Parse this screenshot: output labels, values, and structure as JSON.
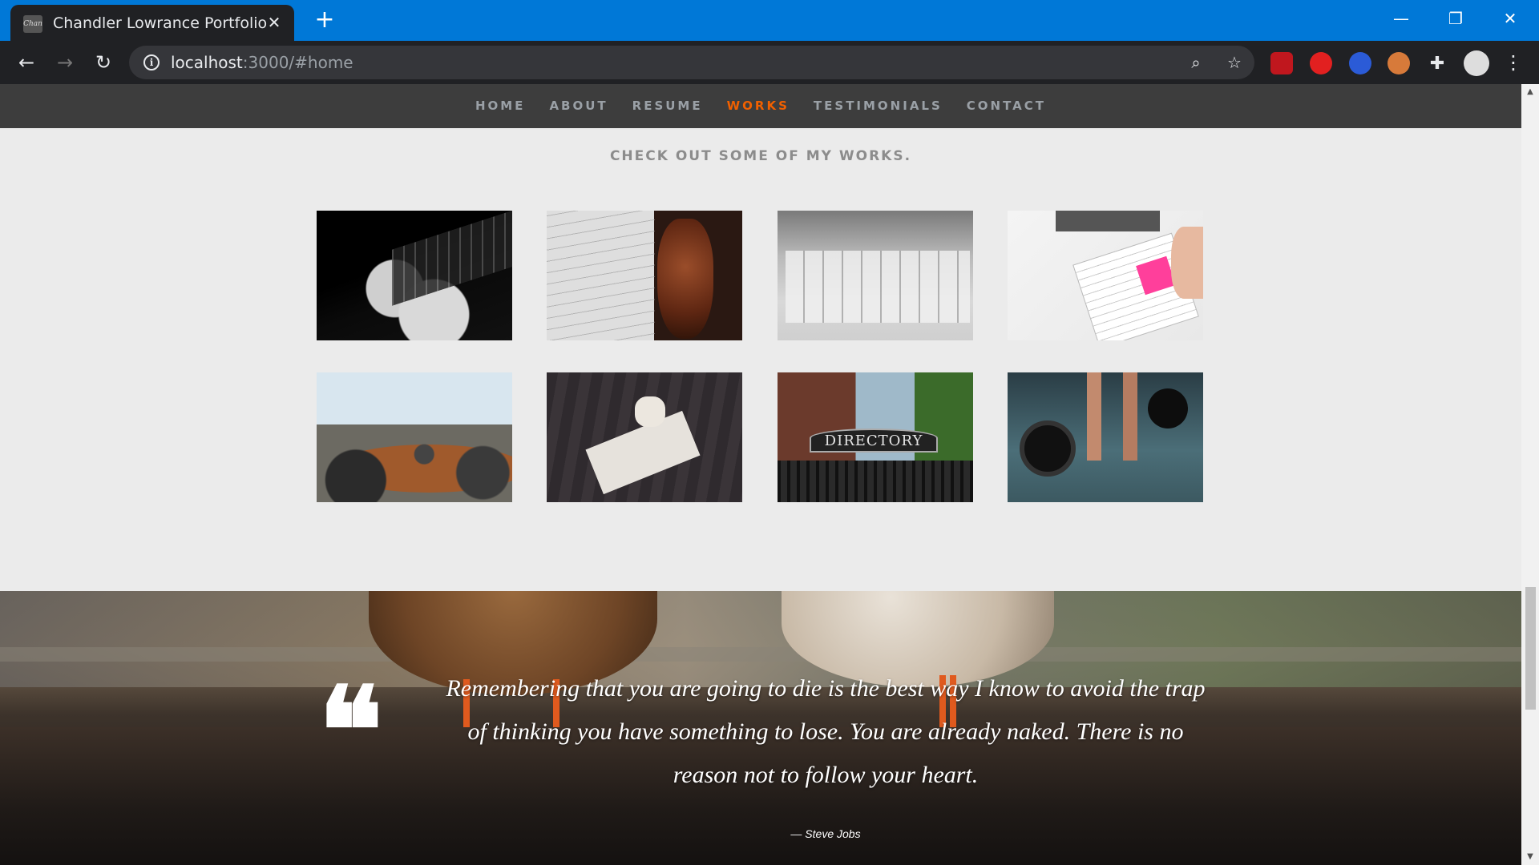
{
  "browser": {
    "tab_title": "Chandler Lowrance Portfolio",
    "tab_favicon_text": "Chan",
    "url_host": "localhost",
    "url_path": ":3000/#home"
  },
  "site": {
    "nav": [
      {
        "label": "HOME",
        "active": false
      },
      {
        "label": "ABOUT",
        "active": false
      },
      {
        "label": "RESUME",
        "active": false
      },
      {
        "label": "WORKS",
        "active": true
      },
      {
        "label": "TESTIMONIALS",
        "active": false
      },
      {
        "label": "CONTACT",
        "active": false
      }
    ],
    "accent_color": "#f06000",
    "works_heading": "CHECK OUT SOME OF MY WORKS.",
    "works": [
      {
        "image": "astronaut-in-space"
      },
      {
        "image": "sheet-music-and-violin"
      },
      {
        "image": "toy-on-keyboard"
      },
      {
        "image": "planner-with-sticky-note"
      },
      {
        "image": "meeting-room"
      },
      {
        "image": "book-and-coffee-cup"
      },
      {
        "image": "directory-sign",
        "image_text": "DIRECTORY"
      },
      {
        "image": "barbell-weightlifting"
      }
    ],
    "testimonial": {
      "text": "Remembering that you are going to die is the best way I know to avoid the trap of thinking you have something to lose. You are already naked. There is no reason not to follow your heart.",
      "author": "— Steve Jobs"
    }
  }
}
